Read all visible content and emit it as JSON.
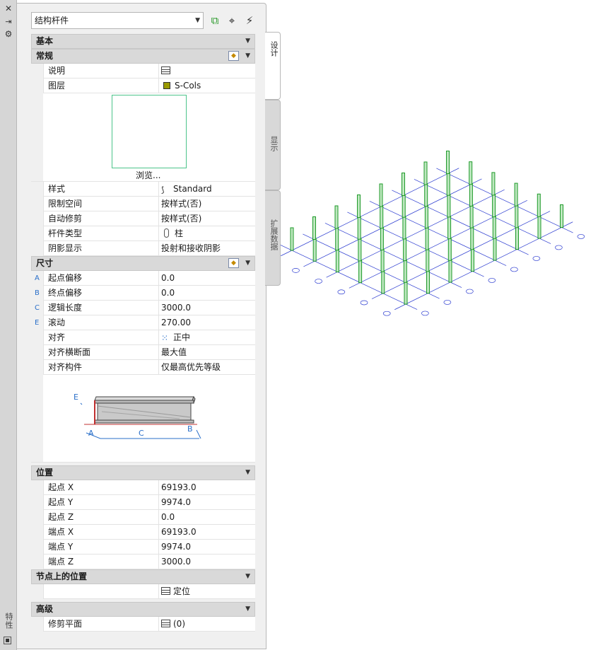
{
  "palette": {
    "title": "特性",
    "object_type": "结构杆件",
    "toolbar_icons": [
      "add-selection-icon",
      "pick-point-icon",
      "quick-select-icon"
    ],
    "strip_icons": [
      "close-icon",
      "auto-hide-icon",
      "settings-icon"
    ]
  },
  "tabs": {
    "design": "设计",
    "display": "显示",
    "extended": "扩展数据"
  },
  "sections": {
    "basic": "基本",
    "general": "常规",
    "dimensions": "尺寸",
    "location": "位置",
    "node_location": "节点上的位置",
    "advanced": "高级"
  },
  "general": {
    "description": {
      "label": "说明",
      "value": ""
    },
    "layer": {
      "label": "图层",
      "value": "S-Cols",
      "swatch": "#9a9a00"
    },
    "browse_label": "浏览...",
    "style": {
      "label": "样式",
      "value": "Standard"
    },
    "bound_spaces": {
      "label": "限制空间",
      "value": "按样式(否)"
    },
    "auto_trim": {
      "label": "自动修剪",
      "value": "按样式(否)"
    },
    "member_type": {
      "label": "杆件类型",
      "value": "柱"
    },
    "shadow_display": {
      "label": "阴影显示",
      "value": "投射和接收阴影"
    }
  },
  "dimensions": {
    "start_offset": {
      "letter": "A",
      "label": "起点偏移",
      "value": "0.0"
    },
    "end_offset": {
      "letter": "B",
      "label": "终点偏移",
      "value": "0.0"
    },
    "logical_length": {
      "letter": "C",
      "label": "逻辑长度",
      "value": "3000.0"
    },
    "roll": {
      "letter": "E",
      "label": "滚动",
      "value": "270.00"
    },
    "justify": {
      "label": "对齐",
      "value": "正中"
    },
    "justify_cross_section": {
      "label": "对齐横断面",
      "value": "最大值"
    },
    "justify_components": {
      "label": "对齐构件",
      "value": "仅最高优先等级"
    },
    "diagram_labels": {
      "a": "A",
      "b": "B",
      "c": "C",
      "e": "E"
    }
  },
  "location": {
    "start_x": {
      "label": "起点 X",
      "value": "69193.0"
    },
    "start_y": {
      "label": "起点 Y",
      "value": "9974.0"
    },
    "start_z": {
      "label": "起点 Z",
      "value": "0.0"
    },
    "end_x": {
      "label": "端点 X",
      "value": "69193.0"
    },
    "end_y": {
      "label": "端点 Y",
      "value": "9974.0"
    },
    "end_z": {
      "label": "端点 Z",
      "value": "3000.0"
    }
  },
  "node_location": {
    "value": "定位"
  },
  "advanced": {
    "trim_planes": {
      "label": "修剪平面",
      "value": "(0)"
    }
  },
  "colors": {
    "grid": "#2a3ad0",
    "column": "#1f9a2a",
    "accent": "#2a6fc9"
  }
}
